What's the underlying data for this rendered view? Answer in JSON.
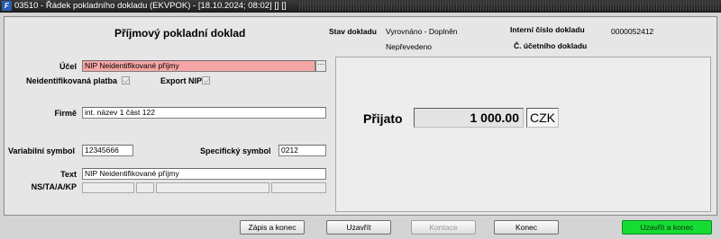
{
  "window": {
    "title": "03510 - Řádek pokladního dokladu (EKVPOK) - [18.10.2024; 08:02] [] []",
    "app_icon_glyph": "F"
  },
  "form": {
    "title": "Příjmový pokladní doklad",
    "stav_dokladu_label": "Stav dokladu",
    "stav_dokladu_value_1": "Vyrovnáno - Doplněn",
    "stav_dokladu_value_2": "Nepřevedeno",
    "interni_cislo_label": "Interní číslo dokladu",
    "interni_cislo_value": "0000052412",
    "ucetni_doklad_label": "Č. účetního dokladu",
    "ucetni_doklad_value": "",
    "ucel_label": "Účel",
    "ucel_value": "NIP Neidentifikované příjmy",
    "lookup_glyph": "···",
    "neidentifikovana_platba_label": "Neidentifikovaná platba",
    "export_nip_label": "Export NIP",
    "firme_label": "Firmě",
    "firme_value": "int. název 1 část 122",
    "variabilni_symbol_label": "Variabilní symbol",
    "variabilni_symbol_value": "12345666",
    "specificky_symbol_label": "Specifický symbol",
    "specificky_symbol_value": "0212",
    "text_label": "Text",
    "text_value": "NIP Neidentifikované příjmy",
    "ns_ta_label": "NS/TA/A/KP",
    "ns_ta_values": [
      "",
      "",
      "",
      ""
    ]
  },
  "payment": {
    "prijato_label": "Přijato",
    "amount": "1 000.00",
    "currency": "CZK"
  },
  "buttons": {
    "zapis_a_konec": "Zápis a konec",
    "uzavrit": "Uzavřít",
    "kontace": "Kontace",
    "konec": "Konec",
    "uzavrit_a_konec": "Uzavřít a konec"
  },
  "colors": {
    "invalid_field": "#f5a5a5",
    "primary_button": "#16dc33",
    "titlebar": "#1c1c1c"
  },
  "icons": {
    "app": "app-logo-icon",
    "lookup": "ellipsis-icon",
    "checkbox": "checkmark-icon"
  }
}
